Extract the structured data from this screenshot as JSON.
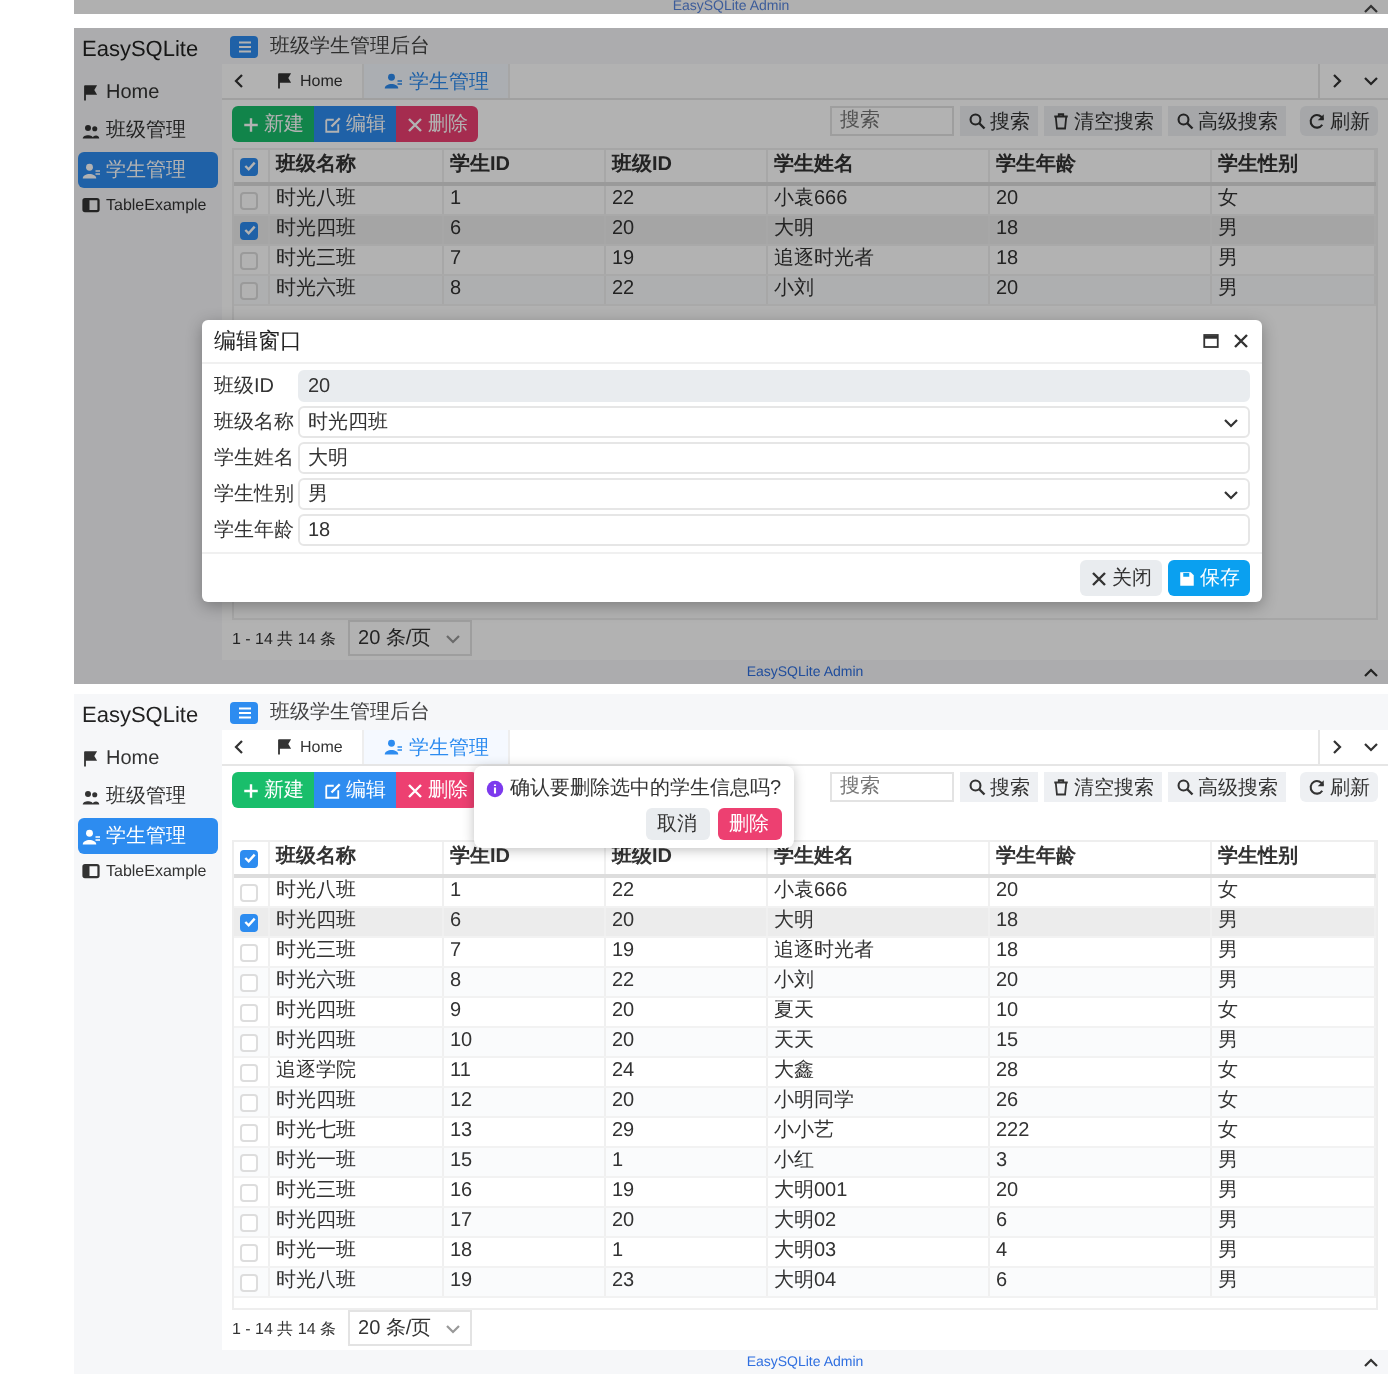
{
  "previous_screen_footer": {
    "text": "EasySQLite Admin"
  },
  "screens": [
    {
      "brand": "EasySQLite",
      "header_title": "班级学生管理后台",
      "sidebar": {
        "items": [
          {
            "label": "Home",
            "selected": false
          },
          {
            "label": "班级管理",
            "selected": false
          },
          {
            "label": "学生管理",
            "selected": true
          },
          {
            "label": "TableExample",
            "selected": false
          }
        ]
      },
      "tabs": [
        {
          "label": "Home",
          "selected": false
        },
        {
          "label": "学生管理",
          "selected": true
        }
      ],
      "action_buttons": [
        "新建",
        "编辑",
        "删除"
      ],
      "search": {
        "placeholder": "搜索"
      },
      "search_buttons": [
        "搜索",
        "清空搜索",
        "高级搜索",
        "刷新"
      ],
      "table": {
        "header_checked": true,
        "columns": [
          "班级名称",
          "学生ID",
          "班级ID",
          "学生姓名",
          "学生年龄",
          "学生性别"
        ],
        "rows": [
          {
            "selected": false,
            "cells": [
              "时光八班",
              "1",
              "22",
              "小袁666",
              "20",
              "女"
            ]
          },
          {
            "selected": true,
            "cells": [
              "时光四班",
              "6",
              "20",
              "大明",
              "18",
              "男"
            ]
          },
          {
            "selected": false,
            "cells": [
              "时光三班",
              "7",
              "19",
              "追逐时光者",
              "18",
              "男"
            ]
          },
          {
            "selected": false,
            "cells": [
              "时光六班",
              "8",
              "22",
              "小刘",
              "20",
              "男"
            ]
          }
        ]
      },
      "pagination": {
        "summary": "1 - 14 共 14 条",
        "page_size": "20 条/页"
      },
      "footer": "EasySQLite Admin",
      "dialog": {
        "kind": "modal",
        "title": "编辑窗口",
        "fields": [
          {
            "kind": "input",
            "label": "班级ID",
            "value": "20",
            "disabled": true
          },
          {
            "kind": "select",
            "label": "班级名称",
            "value": "时光四班",
            "disabled": false
          },
          {
            "kind": "input",
            "label": "学生姓名",
            "value": "大明",
            "disabled": false
          },
          {
            "kind": "select",
            "label": "学生性别",
            "value": "男",
            "disabled": false
          },
          {
            "kind": "input",
            "label": "学生年龄",
            "value": "18",
            "disabled": false
          }
        ],
        "buttons": [
          "关闭",
          "保存"
        ]
      }
    },
    {
      "brand": "EasySQLite",
      "header_title": "班级学生管理后台",
      "sidebar": {
        "items": [
          {
            "label": "Home",
            "selected": false
          },
          {
            "label": "班级管理",
            "selected": false
          },
          {
            "label": "学生管理",
            "selected": true
          },
          {
            "label": "TableExample",
            "selected": false
          }
        ]
      },
      "tabs": [
        {
          "label": "Home",
          "selected": false
        },
        {
          "label": "学生管理",
          "selected": true
        }
      ],
      "action_buttons": [
        "新建",
        "编辑",
        "删除"
      ],
      "search": {
        "placeholder": "搜索"
      },
      "search_buttons": [
        "搜索",
        "清空搜索",
        "高级搜索",
        "刷新"
      ],
      "table": {
        "header_checked": true,
        "columns": [
          "班级名称",
          "学生ID",
          "班级ID",
          "学生姓名",
          "学生年龄",
          "学生性别"
        ],
        "rows": [
          {
            "selected": false,
            "cells": [
              "时光八班",
              "1",
              "22",
              "小袁666",
              "20",
              "女"
            ]
          },
          {
            "selected": true,
            "cells": [
              "时光四班",
              "6",
              "20",
              "大明",
              "18",
              "男"
            ]
          },
          {
            "selected": false,
            "cells": [
              "时光三班",
              "7",
              "19",
              "追逐时光者",
              "18",
              "男"
            ]
          },
          {
            "selected": false,
            "cells": [
              "时光六班",
              "8",
              "22",
              "小刘",
              "20",
              "男"
            ]
          },
          {
            "selected": false,
            "cells": [
              "时光四班",
              "9",
              "20",
              "夏天",
              "10",
              "女"
            ]
          },
          {
            "selected": false,
            "cells": [
              "时光四班",
              "10",
              "20",
              "天天",
              "15",
              "男"
            ]
          },
          {
            "selected": false,
            "cells": [
              "追逐学院",
              "11",
              "24",
              "大鑫",
              "28",
              "女"
            ]
          },
          {
            "selected": false,
            "cells": [
              "时光四班",
              "12",
              "20",
              "小明同学",
              "26",
              "女"
            ]
          },
          {
            "selected": false,
            "cells": [
              "时光七班",
              "13",
              "29",
              "小小艺",
              "222",
              "女"
            ]
          },
          {
            "selected": false,
            "cells": [
              "时光一班",
              "15",
              "1",
              "小红",
              "3",
              "男"
            ]
          },
          {
            "selected": false,
            "cells": [
              "时光三班",
              "16",
              "19",
              "大明001",
              "20",
              "男"
            ]
          },
          {
            "selected": false,
            "cells": [
              "时光四班",
              "17",
              "20",
              "大明02",
              "6",
              "男"
            ]
          },
          {
            "selected": false,
            "cells": [
              "时光一班",
              "18",
              "1",
              "大明03",
              "4",
              "男"
            ]
          },
          {
            "selected": false,
            "cells": [
              "时光八班",
              "19",
              "23",
              "大明04",
              "6",
              "男"
            ]
          }
        ]
      },
      "pagination": {
        "summary": "1 - 14 共 14 条",
        "page_size": "20 条/页"
      },
      "footer": "EasySQLite Admin",
      "dialog": {
        "kind": "popconfirm",
        "message": "确认要删除选中的学生信息吗?",
        "buttons": [
          "取消",
          "删除"
        ]
      }
    }
  ]
}
